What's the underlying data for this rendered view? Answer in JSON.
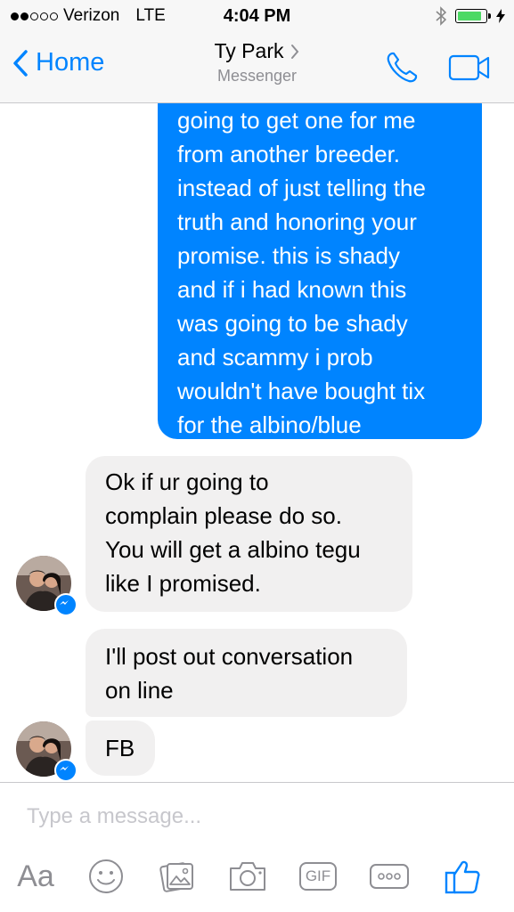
{
  "status_bar": {
    "carrier": "Verizon",
    "network": "LTE",
    "time": "4:04 PM"
  },
  "nav": {
    "back_label": "Home",
    "contact_name": "Ty Park",
    "subtitle": "Messenger"
  },
  "messages": {
    "outgoing_1": {
      "lines": [
        "going to get one for me",
        "from another breeder.",
        "instead of just telling the",
        "truth and honoring your",
        "promise.  this is shady",
        "and if i had known this",
        "was going to be shady",
        "and scammy i prob",
        "wouldn't have bought tix",
        "for the albino/blue"
      ]
    },
    "incoming_1": {
      "lines": [
        "Ok if ur going to",
        "complain please do so.",
        "You will get a albino tegu",
        "like I promised."
      ]
    },
    "incoming_2": {
      "lines": [
        "I'll post out conversation",
        "on line"
      ]
    },
    "incoming_3": {
      "lines": [
        "FB"
      ]
    }
  },
  "composer": {
    "placeholder": "Type a message...",
    "text_tool_label": "Aa",
    "gif_label": "GIF"
  },
  "colors": {
    "accent": "#0084ff",
    "incoming_bubble": "#f1f0f0",
    "battery": "#4cd964"
  },
  "icons": [
    "bluetooth-icon",
    "battery-icon",
    "chevron-left-icon",
    "chevron-right-icon",
    "phone-icon",
    "video-camera-icon",
    "emoji-icon",
    "photos-icon",
    "camera-icon",
    "gif-icon",
    "more-icon",
    "like-icon",
    "messenger-badge-icon"
  ]
}
